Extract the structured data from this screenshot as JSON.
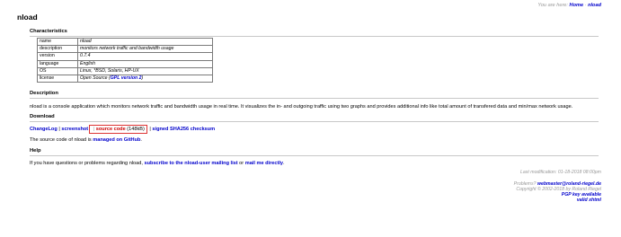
{
  "breadcrumb": {
    "prefix": "You are here: ",
    "home": "Home",
    "separator": " · ",
    "current": "nload"
  },
  "page_title": "nload",
  "characteristics": {
    "heading": "Characteristics",
    "rows": [
      {
        "key": "name",
        "value": "nload"
      },
      {
        "key": "description",
        "value": "monitors network traffic and bandwidth usage"
      },
      {
        "key": "version",
        "value": "0.7.4"
      },
      {
        "key": "language",
        "value": "English"
      },
      {
        "key": "OS",
        "value": "Linux, *BSD, Solaris, HP-UX"
      }
    ],
    "license_key": "license",
    "license_prefix": "Open Source (",
    "license_link": "GPL version 2",
    "license_suffix": ")"
  },
  "description": {
    "heading": "Description",
    "text": "nload is a console application which monitors network traffic and bandwidth usage in real time. It visualizes the in- and outgoing traffic using two graphs and provides additional info like total amount of transfered data and min/max network usage."
  },
  "download": {
    "heading": "Download",
    "changelog": "ChangeLog",
    "sep": " | ",
    "screenshot": "screenshot",
    "source_code": "source code",
    "source_size": " (148kB)",
    "checksum": "signed SHA256 checksum",
    "github_prefix": "The source code of nload is ",
    "github_link": "managed on GitHub",
    "github_suffix": "."
  },
  "help": {
    "heading": "Help",
    "prefix": "If you have questions or problems regarding nload, ",
    "mailing_list": "subscribe to the nload-user mailing list",
    "middle": " or ",
    "mail_me": "mail me directly",
    "suffix": "."
  },
  "footer": {
    "last_modification": "Last modification: 01-18-2018 08:00pm",
    "problems_prefix": "Problems? ",
    "webmaster": "webmaster@roland-riegel.de",
    "copyright": "Copyright © 2002-2018 by Roland Riegel",
    "pgp": "PGP key available",
    "xhtml": "valid xhtml"
  }
}
